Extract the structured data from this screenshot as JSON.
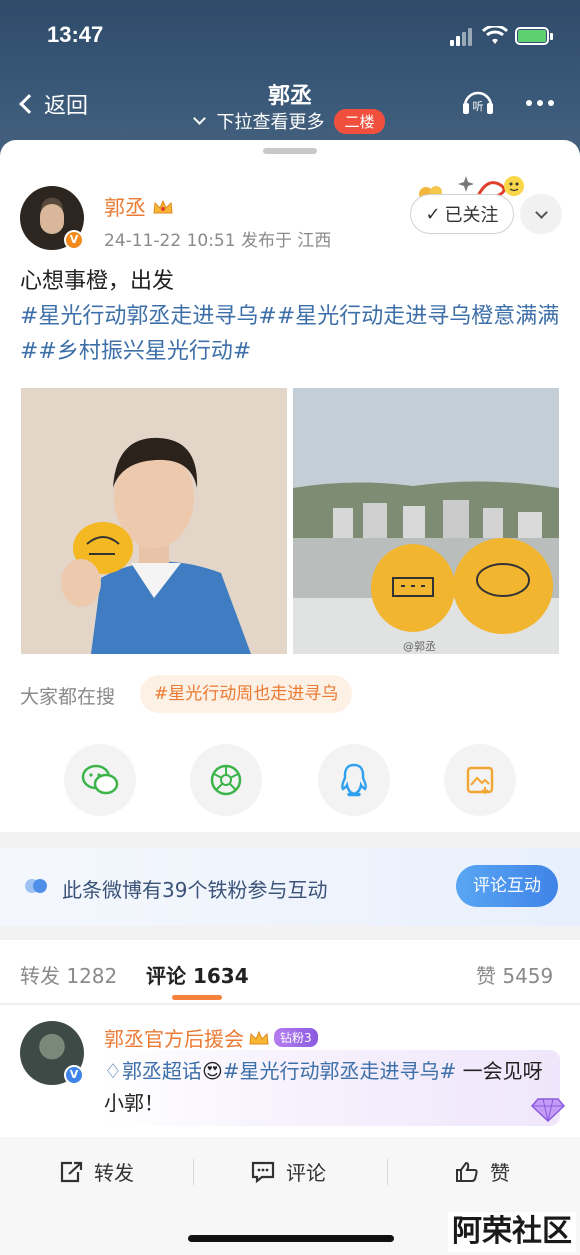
{
  "status_bar": {
    "time": "13:47"
  },
  "nav": {
    "back_label": "返回",
    "title": "郭丞",
    "subtitle": "下拉查看更多",
    "floor_badge": "二楼"
  },
  "post": {
    "author": "郭丞",
    "verified_badge": "V",
    "meta": "24-11-22 10:51  发布于 江西",
    "follow_label": "已关注",
    "text": "心想事橙，出发",
    "hashtags": "#星光行动郭丞走进寻乌##星光行动走进寻乌橙意满满##乡村振兴星光行动#",
    "image2_watermark": "@郭丞"
  },
  "search": {
    "label": "大家都在搜",
    "tag": "#星光行动周也走进寻乌"
  },
  "share_icons": [
    "wechat-icon",
    "moments-icon",
    "qq-icon",
    "save-image-icon"
  ],
  "fan_bar": {
    "text": "此条微博有39个铁粉参与互动",
    "button": "评论互动"
  },
  "tabs": {
    "repost": "转发 1282",
    "comment": "评论 1634",
    "like": "赞 5459"
  },
  "comment": {
    "author": "郭丞官方后援会",
    "fan_badge": "钻粉3",
    "text_prefix": "郭丞超话",
    "hashtag": "#星光行动郭丞走进寻乌#",
    "text_suffix": " 一会见呀小郭！"
  },
  "bottom_bar": {
    "repost": "转发",
    "comment": "评论",
    "like": "赞"
  },
  "watermark": "阿荣社区",
  "colors": {
    "accent_orange": "#eb7a33",
    "link_blue": "#3d6fa8",
    "header_bg": "#3a5878"
  }
}
